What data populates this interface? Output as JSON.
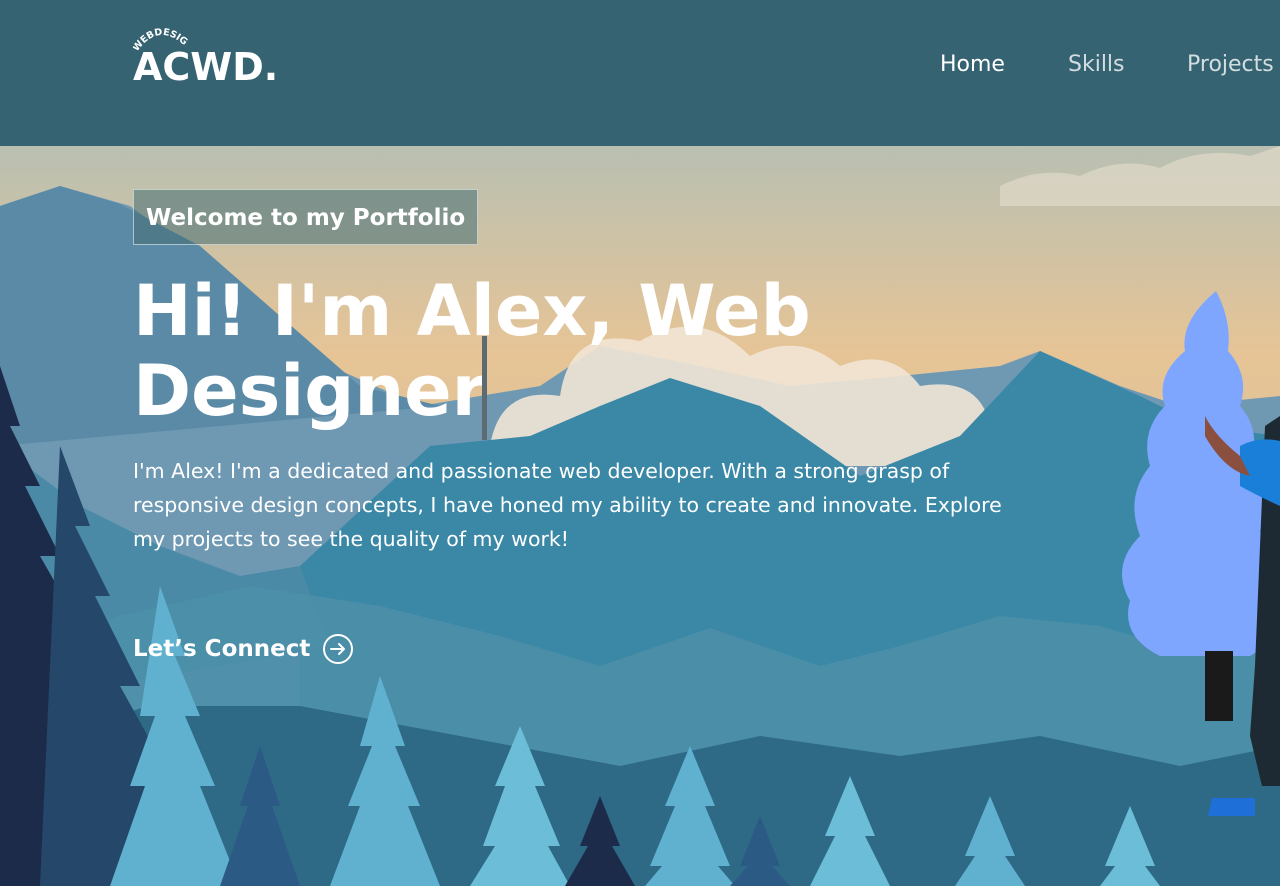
{
  "brand": {
    "logo_small": "WEBDESIGN",
    "logo_main": "ACWD."
  },
  "nav": {
    "items": [
      {
        "label": "Home"
      },
      {
        "label": "Skills"
      },
      {
        "label": "Projects"
      }
    ]
  },
  "hero": {
    "tagline": "Welcome to my Portfolio",
    "headline": "Hi! I'm Alex, Web Designer",
    "intro": "I'm Alex! I'm a dedicated and passionate web developer. With a strong grasp of responsive design concepts, I have honed my ability to create and innovate. Explore my projects to see the quality of my work!",
    "cta_label": "Let’s Connect",
    "cta_icon": "arrow-right-circle-icon"
  },
  "colors": {
    "navbar": "#356372",
    "sky_top": "#b9c0b2",
    "sky_mid": "#e6c496",
    "mountain_far": "#4f87a4",
    "mountain_mid": "#3a88a6",
    "forest_dark": "#1d2b4a",
    "forest_light": "#5fb1cf",
    "tree_blue": "#7ea6ff",
    "text": "#ffffff"
  }
}
